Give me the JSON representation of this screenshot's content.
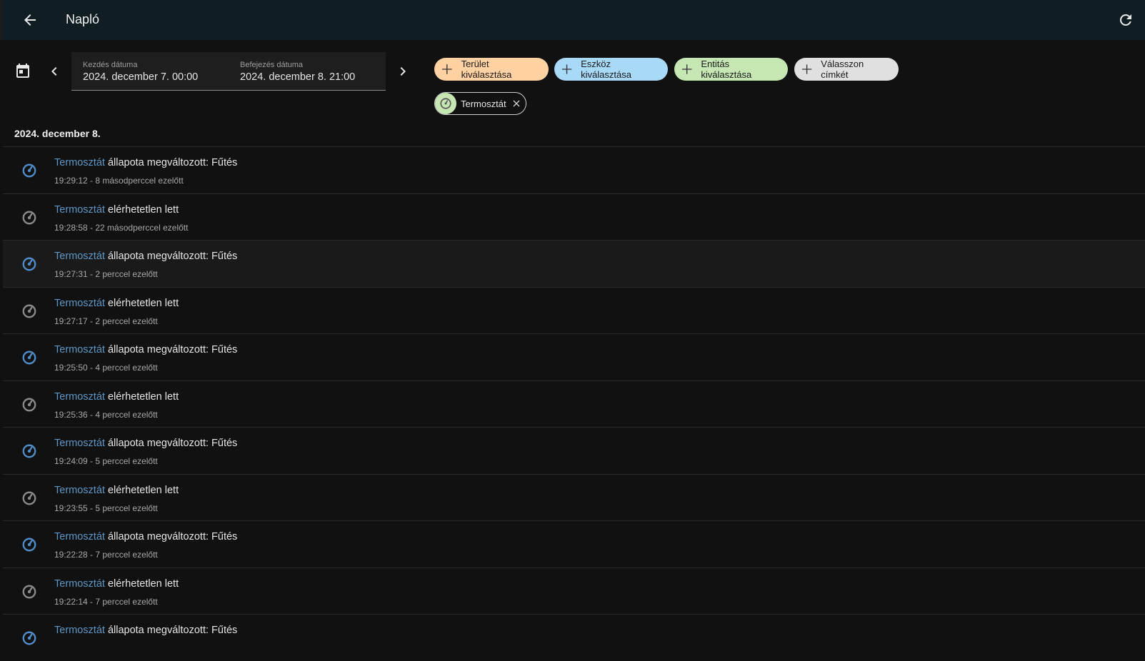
{
  "header": {
    "title": "Napló",
    "back_icon": "arrow-left-icon",
    "refresh_icon": "refresh-icon"
  },
  "filters": {
    "start_label": "Kezdés dátuma",
    "start_value": "2024. december 7. 00:00",
    "end_label": "Befejezés dátuma",
    "end_value": "2024. december 8. 21:00",
    "chips": {
      "area": "Terület kiválasztása",
      "device": "Eszköz kiválasztása",
      "entity": "Entitás kiválasztása",
      "label": "Válasszon címkét"
    },
    "selected_entity": "Termosztát"
  },
  "colors": {
    "area_chip": "#ffd1a3",
    "device_chip": "#a8d9f7",
    "entity_chip": "#c6e7b4",
    "label_chip": "#e0e0e0",
    "link": "#5e97c7",
    "active_icon": "#4f8cc9",
    "inactive_icon": "#8a8a8a"
  },
  "logbook": {
    "day": "2024. december 8.",
    "entries": [
      {
        "entity": "Termosztát",
        "message": "állapota megváltozott: Fűtés",
        "time": "19:29:12 - 8 másodperccel ezelőtt",
        "icon": "thermostat-icon",
        "active": true
      },
      {
        "entity": "Termosztát",
        "message": "elérhetetlen lett",
        "time": "19:28:58 - 22 másodperccel ezelőtt",
        "icon": "thermostat-icon",
        "active": false
      },
      {
        "entity": "Termosztát",
        "message": "állapota megváltozott: Fűtés",
        "time": "19:27:31 - 2 perccel ezelőtt",
        "icon": "thermostat-icon",
        "active": true
      },
      {
        "entity": "Termosztát",
        "message": "elérhetetlen lett",
        "time": "19:27:17 - 2 perccel ezelőtt",
        "icon": "thermostat-icon",
        "active": false
      },
      {
        "entity": "Termosztát",
        "message": "állapota megváltozott: Fűtés",
        "time": "19:25:50 - 4 perccel ezelőtt",
        "icon": "thermostat-icon",
        "active": true
      },
      {
        "entity": "Termosztát",
        "message": "elérhetetlen lett",
        "time": "19:25:36 - 4 perccel ezelőtt",
        "icon": "thermostat-icon",
        "active": false
      },
      {
        "entity": "Termosztát",
        "message": "állapota megváltozott: Fűtés",
        "time": "19:24:09 - 5 perccel ezelőtt",
        "icon": "thermostat-icon",
        "active": true
      },
      {
        "entity": "Termosztát",
        "message": "elérhetetlen lett",
        "time": "19:23:55 - 5 perccel ezelőtt",
        "icon": "thermostat-icon",
        "active": false
      },
      {
        "entity": "Termosztát",
        "message": "állapota megváltozott: Fűtés",
        "time": "19:22:28 - 7 perccel ezelőtt",
        "icon": "thermostat-icon",
        "active": true
      },
      {
        "entity": "Termosztát",
        "message": "elérhetetlen lett",
        "time": "19:22:14 - 7 perccel ezelőtt",
        "icon": "thermostat-icon",
        "active": false
      },
      {
        "entity": "Termosztát",
        "message": "állapota megváltozott: Fűtés",
        "time": "",
        "icon": "thermostat-icon",
        "active": true
      }
    ]
  }
}
